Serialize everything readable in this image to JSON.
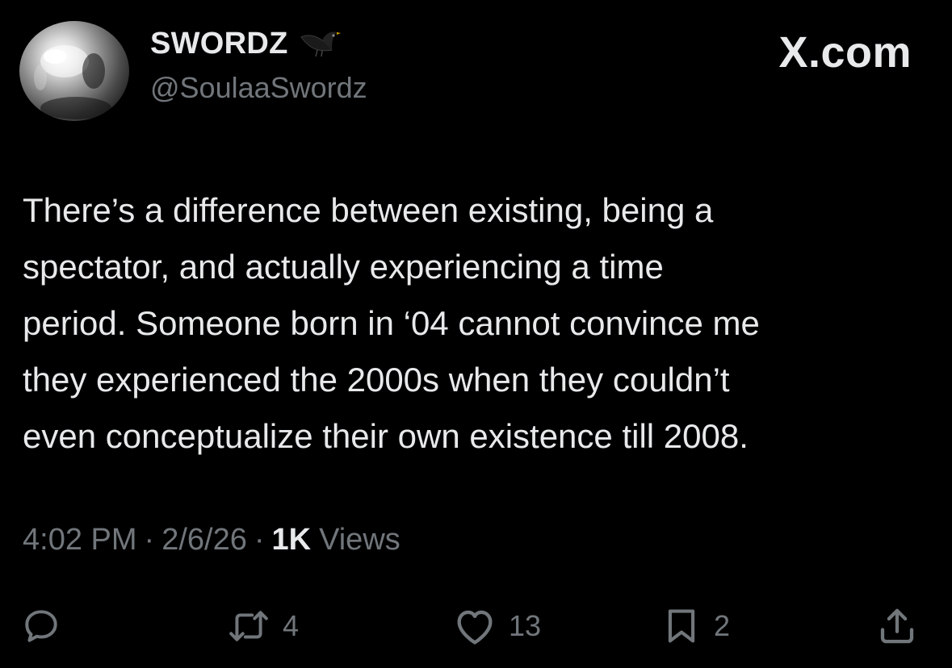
{
  "author": {
    "display_name": "SWORDZ",
    "handle": "@SoulaaSwordz",
    "avatar_icon": "chrome-sphere-avatar",
    "badge_icon": "blackbird-icon"
  },
  "brand": {
    "label": "X.com"
  },
  "tweet": {
    "text": "There’s a difference between existing, being a\nspectator, and actually experiencing a time\nperiod. Someone born in ‘04 cannot convince me\nthey experienced the 2000s when they couldn’t\neven conceptualize their own existence till 2008."
  },
  "meta": {
    "time": "4:02 PM",
    "separator": "·",
    "date": "2/6/26",
    "views_count": "1K",
    "views_label": "Views"
  },
  "actions": {
    "reply": {
      "icon": "reply-icon",
      "count": ""
    },
    "repost": {
      "icon": "repost-icon",
      "count": "4"
    },
    "like": {
      "icon": "heart-icon",
      "count": "13"
    },
    "bookmark": {
      "icon": "bookmark-icon",
      "count": "2"
    },
    "share": {
      "icon": "share-icon",
      "count": ""
    }
  },
  "colors": {
    "background": "#000000",
    "primary_text": "#e7e9ea",
    "secondary_text": "#71767b"
  }
}
